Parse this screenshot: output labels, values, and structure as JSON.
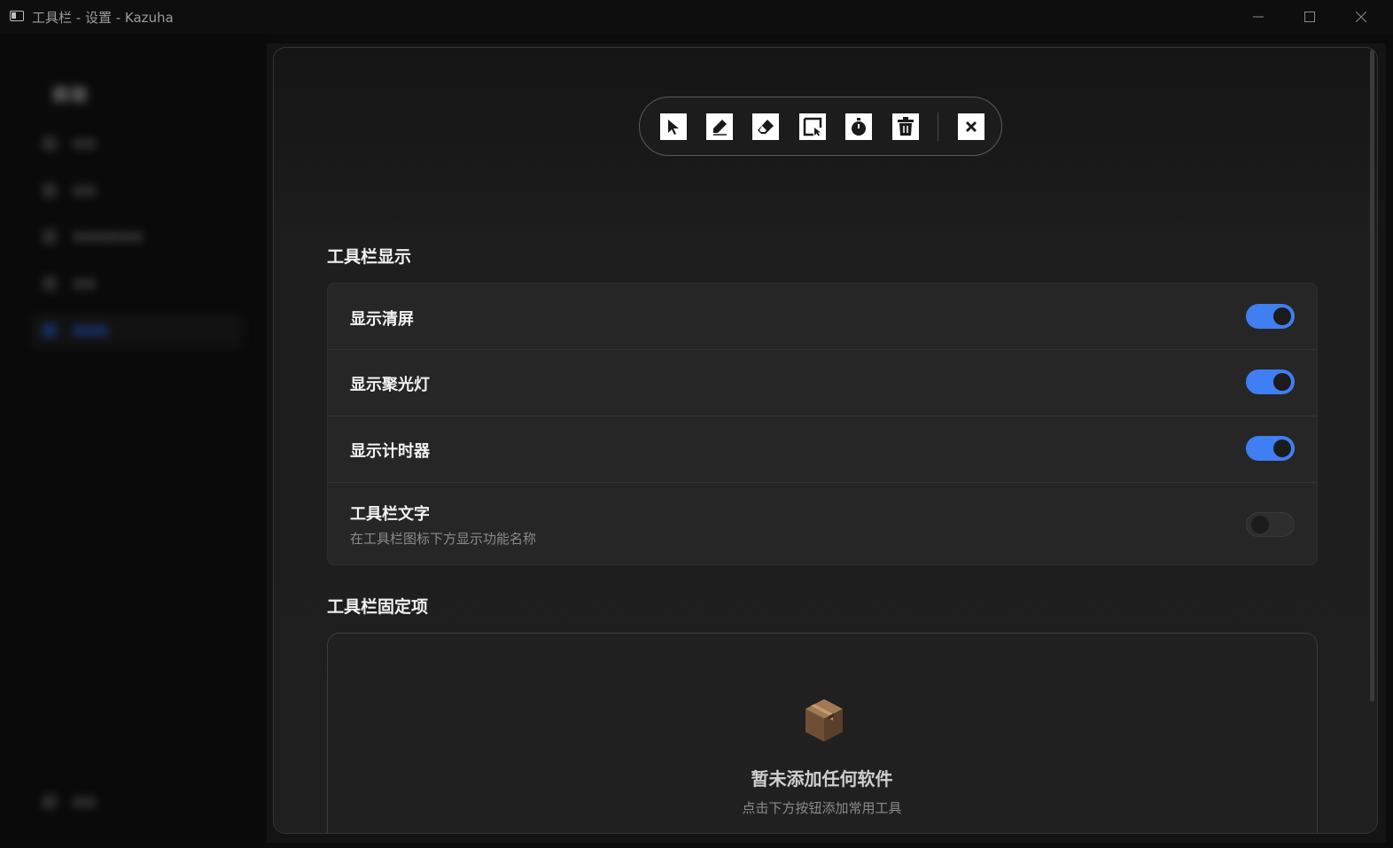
{
  "window": {
    "title": "工具栏 - 设置 - Kazuha"
  },
  "toolbar_preview": {
    "buttons": [
      {
        "name": "select",
        "icon": "cursor-icon"
      },
      {
        "name": "pen",
        "icon": "pen-icon"
      },
      {
        "name": "eraser",
        "icon": "eraser-icon"
      },
      {
        "name": "screenshot",
        "icon": "screenshot-icon"
      },
      {
        "name": "timer",
        "icon": "timer-icon"
      },
      {
        "name": "clear",
        "icon": "trash-icon"
      },
      {
        "name": "close",
        "icon": "close-icon"
      }
    ]
  },
  "display_section": {
    "title": "工具栏显示",
    "rows": [
      {
        "label": "显示清屏",
        "enabled": true
      },
      {
        "label": "显示聚光灯",
        "enabled": true
      },
      {
        "label": "显示计时器",
        "enabled": true
      },
      {
        "label": "工具栏文字",
        "description": "在工具栏图标下方显示功能名称",
        "enabled": false
      }
    ]
  },
  "pinned_section": {
    "title": "工具栏固定项",
    "empty_title": "暂未添加任何软件",
    "empty_subtitle": "点击下方按钮添加常用工具"
  },
  "colors": {
    "accent": "#3f7ef3",
    "background": "#1f1f1f",
    "card": "#262626"
  }
}
